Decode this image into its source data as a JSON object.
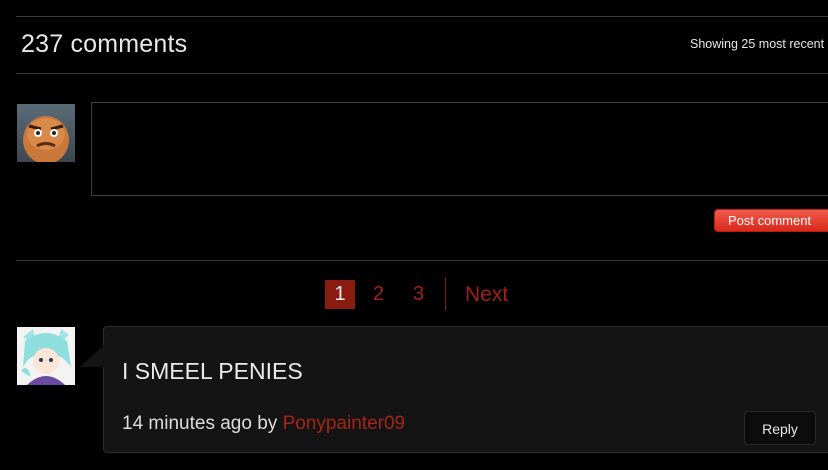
{
  "header": {
    "comment_count": "237 comments",
    "sort_info": "Showing 25 most recent"
  },
  "composer": {
    "post_label": "Post comment",
    "accent_color": "#e2362a"
  },
  "pagination": {
    "current": "1",
    "pages": [
      "2",
      "3"
    ],
    "next_label": "Next",
    "link_color": "#9e2218"
  },
  "comments": [
    {
      "text": "I SMEEL PENIES",
      "time": "14 minutes ago",
      "by": "by",
      "author": "Ponypainter09",
      "reply_label": "Reply"
    }
  ]
}
